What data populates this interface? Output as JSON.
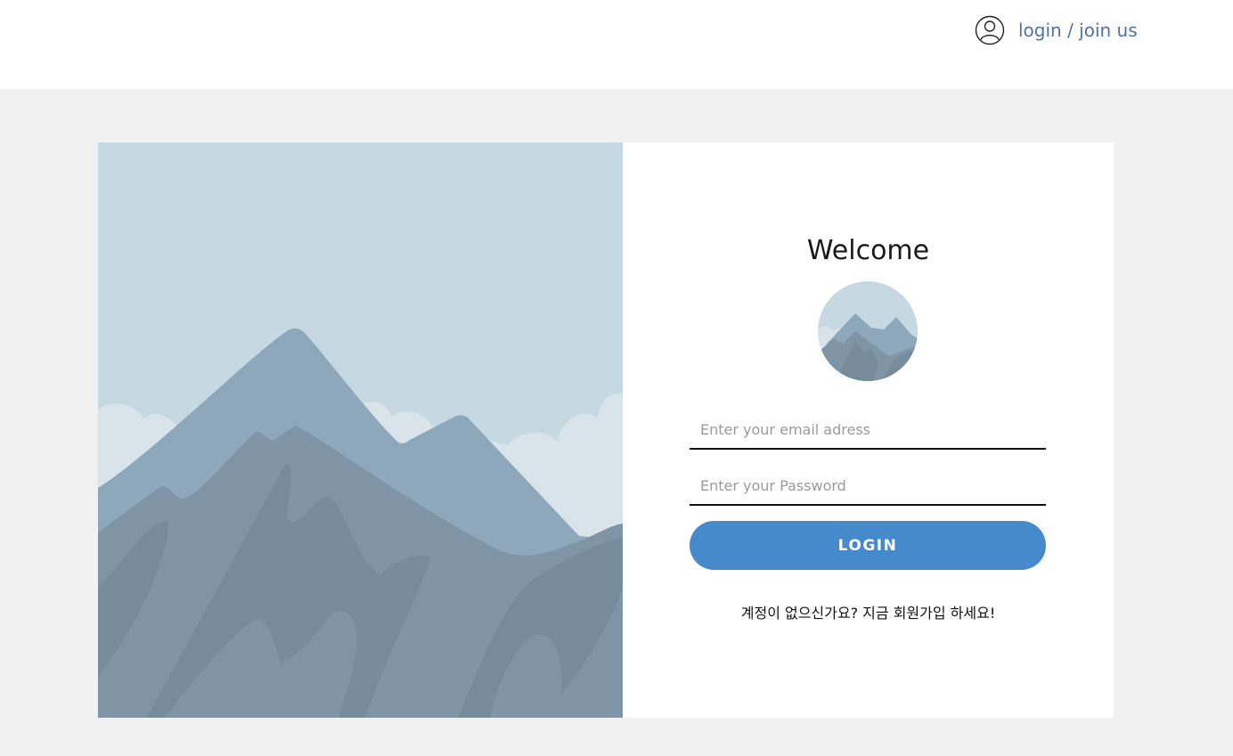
{
  "header": {
    "login_label": "login / join us",
    "icon": "user-circle-icon"
  },
  "login_form": {
    "title": "Welcome",
    "email_placeholder": "Enter your email adress",
    "password_placeholder": "Enter your Password",
    "submit_label": "LOGIN",
    "signup_text": "계정이 없으신가요?  지금 회원가입 하세요!"
  },
  "colors": {
    "accent": "#468acb",
    "sky": "#c6d8e1",
    "mountain_light": "#8da8bb",
    "mountain_mid": "#7f95a5",
    "mountain_dark": "#768c9b",
    "cloud": "#d9e3ea",
    "link": "#4e73a0",
    "page_bg": "#f1f1f1"
  }
}
